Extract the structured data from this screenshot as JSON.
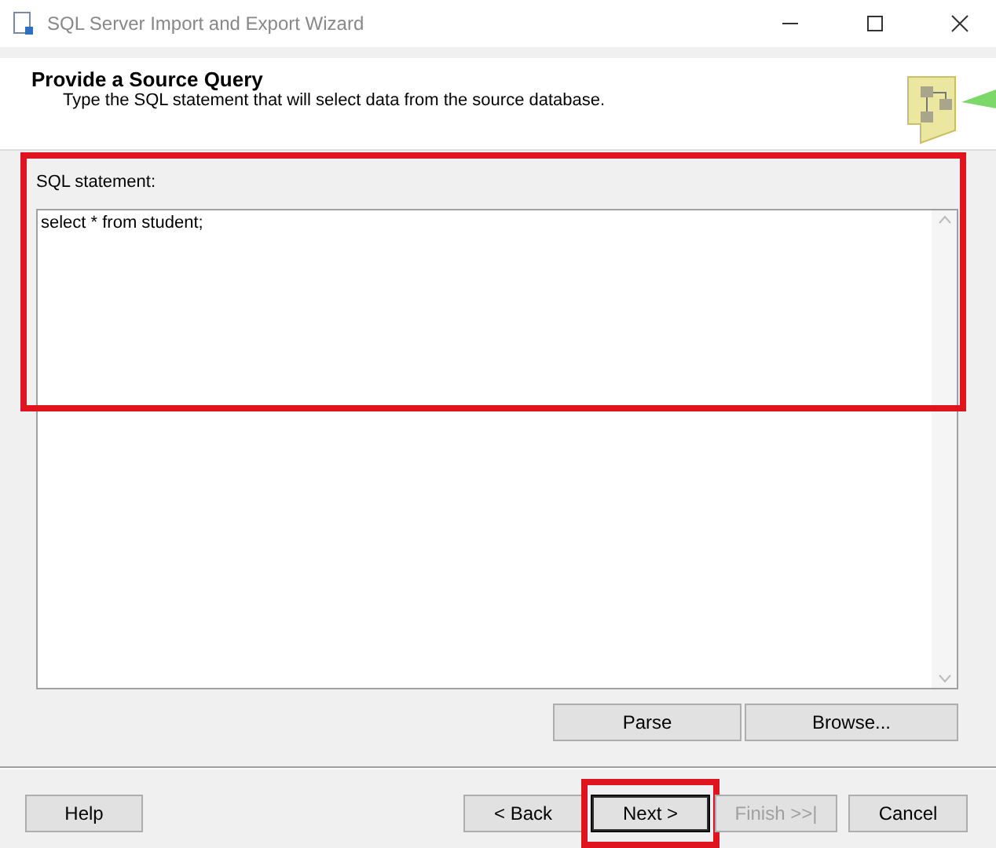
{
  "window": {
    "title": "SQL Server Import and Export Wizard"
  },
  "header": {
    "title": "Provide a Source Query",
    "subtitle": "Type the SQL statement that will select data from the source database."
  },
  "sql": {
    "label": "SQL statement:",
    "value": "select * from student;",
    "highlighted": true
  },
  "actions": [
    {
      "label": "Parse",
      "disabled": false
    },
    {
      "label": "Browse...",
      "disabled": false
    }
  ],
  "left_buttons": [
    {
      "label": "Help",
      "disabled": false,
      "highlighted": false,
      "default": false
    }
  ],
  "right_buttons": [
    {
      "label": "< Back",
      "disabled": false,
      "highlighted": false,
      "default": false
    },
    {
      "label": "Next >",
      "disabled": false,
      "highlighted": true,
      "default": true
    },
    {
      "label": "Finish >>|",
      "disabled": true,
      "highlighted": false,
      "default": false
    },
    {
      "label": "Cancel",
      "disabled": false,
      "highlighted": false,
      "default": false
    }
  ]
}
